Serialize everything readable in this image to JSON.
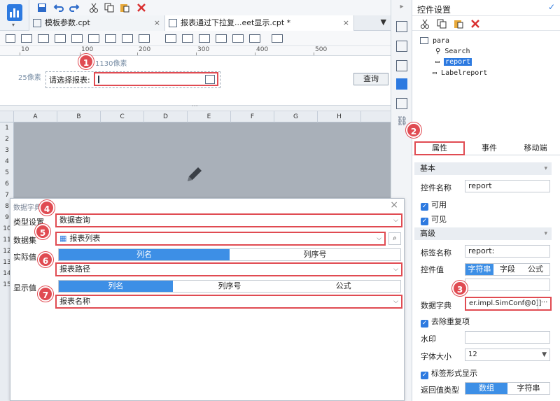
{
  "tabs": [
    {
      "label": "模板参数.cpt",
      "close": "×"
    },
    {
      "label": "报表通过下拉复...eet显示.cpt *",
      "close": "×"
    }
  ],
  "ruler": {
    "unit_label": "1130像素",
    "ticks": [
      "10",
      "100",
      "200",
      "300",
      "400",
      "500"
    ]
  },
  "form": {
    "row_height_label": "25像素",
    "prompt_label": "请选择报表:",
    "query_button": "查询"
  },
  "grid": {
    "columns": [
      "A",
      "B",
      "C",
      "D",
      "E",
      "F",
      "G",
      "H"
    ],
    "rows": [
      "1",
      "2",
      "3",
      "4",
      "5",
      "6",
      "7",
      "8",
      "9",
      "10",
      "11",
      "12",
      "13",
      "14",
      "15"
    ]
  },
  "dialog": {
    "title": "数据字典",
    "close": "×",
    "type_label": "类型设置",
    "type_value": "数据查询",
    "dataset_label": "数据集",
    "dataset_value": "报表列表",
    "actual_label": "实际值",
    "actual_tabs": [
      "列名",
      "列序号"
    ],
    "actual_value": "报表路径",
    "display_label": "显示值",
    "display_tabs": [
      "列名",
      "列序号",
      "公式"
    ],
    "display_value": "报表名称"
  },
  "badges": [
    "1",
    "2",
    "3",
    "4",
    "5",
    "6",
    "7"
  ],
  "panel": {
    "title": "控件设置",
    "tree": {
      "root": "para",
      "children": [
        "Search",
        "report",
        "Labelreport"
      ]
    },
    "tabs": [
      "属性",
      "事件",
      "移动端"
    ],
    "basic_section": "基本",
    "name_label": "控件名称",
    "name_value": "report",
    "enabled_label": "可用",
    "visible_label": "可见",
    "advanced_section": "高级",
    "tag_label": "标签名称",
    "tag_value": "report:",
    "value_label": "控件值",
    "value_tabs": [
      "字符串",
      "字段",
      "公式"
    ],
    "dict_label": "数据字典",
    "dict_value": "er.impl.SimConf@0]]",
    "dict_btn": "···",
    "dedupe_label": "去除重复项",
    "watermark_label": "水印",
    "fontsize_label": "字体大小",
    "fontsize_value": "12",
    "tagform_label": "标签形式显示",
    "return_label": "返回值类型",
    "return_tabs": [
      "数组",
      "字符串"
    ]
  },
  "colors": {
    "accent": "#2d7ae0",
    "highlight": "#e04b52",
    "segment_on": "#3d8fe6"
  }
}
